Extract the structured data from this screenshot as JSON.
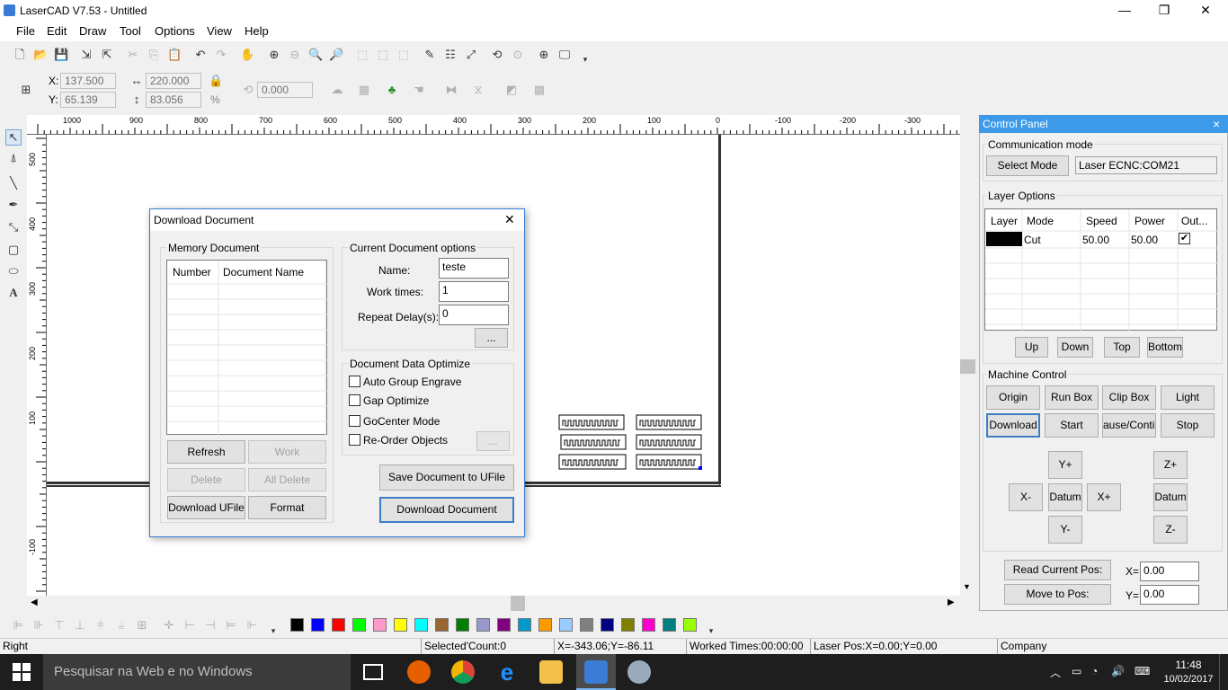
{
  "window": {
    "title": "LaserCAD V7.53 - Untitled",
    "minimize": "—",
    "restore": "❐",
    "close": "✕"
  },
  "menu": [
    "File",
    "Edit",
    "Draw",
    "Tool",
    "Options",
    "View",
    "Help"
  ],
  "coords": {
    "x_label": "X:",
    "x_value": "137.500",
    "y_label": "Y:",
    "y_value": "65.139",
    "w_value": "220.000",
    "h_value": "83.056",
    "rot_value": "0.000",
    "percent": "%"
  },
  "ruler": {
    "h_labels": [
      "1000",
      "900",
      "800",
      "700",
      "600",
      "500",
      "400",
      "300",
      "200",
      "100",
      "0",
      "-100",
      "-200",
      "-300"
    ],
    "v_labels": [
      "500",
      "400",
      "300",
      "200",
      "100",
      "-100"
    ]
  },
  "palette": [
    "#000000",
    "#0000ff",
    "#ff0000",
    "#00ff00",
    "#ff99cc",
    "#ffff00",
    "#00ffff",
    "#996633",
    "#008000",
    "#9999cc",
    "#800080",
    "#0099cc",
    "#ff9900",
    "#99ccff",
    "#808080",
    "#000080",
    "#808000",
    "#ff00cc",
    "#008080",
    "#99ff00"
  ],
  "status": {
    "left": "Right",
    "selected": "Selected'Count:0",
    "pos": "X=-343.06;Y=-86.11",
    "worked": "Worked Times:00:00:00",
    "laser": "Laser Pos:X=0.00;Y=0.00",
    "company": "Company"
  },
  "taskbar": {
    "search": "Pesquisar na Web e no Windows",
    "time": "11:48",
    "date": "10/02/2017"
  },
  "control_panel": {
    "title": "Control Panel",
    "close": "×",
    "comm_group": "Communication mode",
    "select_mode": "Select Mode",
    "mode_value": "Laser ECNC:COM21",
    "layer_group": "Layer Options",
    "layer_headers": [
      "Layer",
      "Mode",
      "Speed",
      "Power",
      "Out..."
    ],
    "layer_row": {
      "mode": "Cut",
      "speed": "50.00",
      "power": "50.00",
      "out": "✔"
    },
    "layer_buttons": [
      "Up",
      "Down",
      "Top",
      "Bottom"
    ],
    "machine_group": "Machine Control",
    "machine_row1": [
      "Origin",
      "Run Box",
      "Clip Box",
      "Light"
    ],
    "machine_row2": [
      "Download",
      "Start",
      "ause/Continu",
      "Stop"
    ],
    "jog": {
      "yplus": "Y+",
      "xminus": "X-",
      "datum": "Datum",
      "xplus": "X+",
      "yminus": "Y-",
      "zplus": "Z+",
      "zdatum": "Datum",
      "zminus": "Z-"
    },
    "read_pos": "Read Current Pos:",
    "move_to": "Move to Pos:",
    "x_label": "X=",
    "x_value": "0.00",
    "y_label": "Y=",
    "y_value": "0.00"
  },
  "dialog": {
    "title": "Download Document",
    "close": "✕",
    "memory_group": "Memory Document",
    "col_number": "Number",
    "col_name": "Document Name",
    "refresh": "Refresh",
    "work": "Work",
    "delete": "Delete",
    "all_delete": "All Delete",
    "download_ufile": "Download UFile",
    "format": "Format",
    "current_group": "Current Document options",
    "name_label": "Name:",
    "name_value": "teste",
    "times_label": "Work times:",
    "times_value": "1",
    "delay_label": "Repeat Delay(s):",
    "delay_value": "0",
    "dots": "...",
    "optimize_group": "Document Data Optimize",
    "opt1": "Auto Group Engrave",
    "opt2": "Gap Optimize",
    "opt3": "GoCenter Mode",
    "opt4": "Re-Order Objects",
    "save_btn": "Save Document to UFile",
    "download_btn": "Download Document"
  }
}
